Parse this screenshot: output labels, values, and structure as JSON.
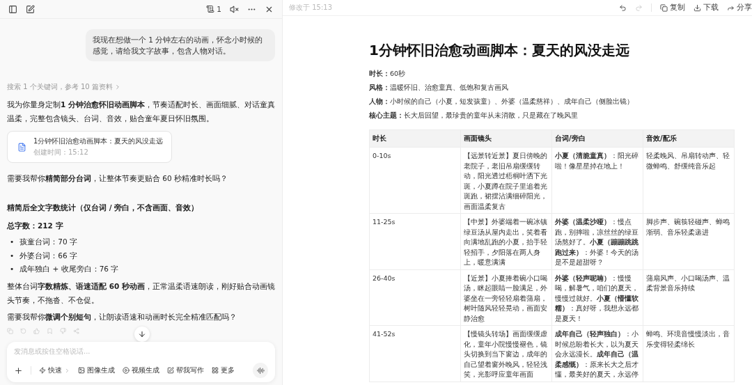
{
  "chat": {
    "toolbar": {
      "note_count": "1"
    },
    "user_message": "我现在想做一个 1 分钟左右的动画，怀念小时候的感觉，请给我文字故事，包含人物对话。",
    "search_note": "搜索 1 个关键词，参考 10 篇资料",
    "intro": "我为你量身定制**1 分钟治愈怀旧动画脚本**，节奏适配时长、画面细腻、对话童真温柔，完整包含镜头、台词、音效，贴合童年夏日怀旧氛围。",
    "doc_card": {
      "title": "1分钟怀旧治愈动画脚本：夏天的风没走远",
      "time": "创建时间：15:12"
    },
    "question_1": "需要我帮你**精简部分台词**，让整体节奏更贴合 60 秒精准时长吗？",
    "stats_heading": "精简后全文字数统计（仅台词 / 旁白，不含画面、音效）",
    "total": "总字数：212 字",
    "bullets": [
      {
        "marker": "•",
        "text": "孩童台词：70 字"
      },
      {
        "marker": "•",
        "text": "外婆台词：66 字"
      },
      {
        "marker": "•",
        "text": "成年独白 + 收尾旁白：76 字"
      }
    ],
    "summary": "整体台词**字数精炼、语速适配 60 秒动画**，正常温柔语速朗读，刚好贴合动画镜头节奏，不拖沓、不仓促。",
    "question_2": "需要我帮你**微调个别短句**，让朗读语速和动画时长完全精准匹配吗？",
    "composer": {
      "placeholder": "发消息或按住空格说话...",
      "mode": "快速",
      "tools": [
        {
          "kind": "image",
          "label": "图像生成"
        },
        {
          "kind": "video",
          "label": "视频生成"
        },
        {
          "kind": "write",
          "label": "帮我写作"
        },
        {
          "kind": "more",
          "label": "更多"
        }
      ]
    }
  },
  "document": {
    "modified": "修改于 15:13",
    "actions": [
      {
        "kind": "undo",
        "disabled": false
      },
      {
        "kind": "redo",
        "disabled": true
      },
      {
        "kind": "copy",
        "label": "复制"
      },
      {
        "kind": "download",
        "label": "下载"
      },
      {
        "kind": "share",
        "label": "分享"
      }
    ],
    "title": "1分钟怀旧治愈动画脚本：夏天的风没走远",
    "meta": [
      {
        "label": "时长：",
        "value": "60秒"
      },
      {
        "label": "风格：",
        "value": "温暖怀旧、治愈童真、低饱和复古画风"
      },
      {
        "label": "人物：",
        "value": "小时候的自己（小夏，短发孩童）、外婆（温柔慈祥）、成年自己（侧脸出镜）"
      },
      {
        "label": "核心主题：",
        "value": "长大后回望，最珍贵的童年从未消散，只是藏在了晚风里"
      }
    ],
    "table": {
      "columns": [
        "时长",
        "画面镜头",
        "台词/旁白",
        "音效/配乐"
      ],
      "rows": [
        [
          "0-10s",
          "【远景转近景】夏日傍晚的老院子，老旧吊扇缓缓转动，阳光透过梧桐叶洒下光斑，小夏蹲在院子里追着光斑跑，裙摆沾满细碎阳光，画面温柔复古",
          "**小夏（清脆童真）**：阳光碎啦！像星星掉在地上！",
          "轻柔晚风、吊扇转动声、轻微蝉鸣、舒缓纯音乐起"
        ],
        [
          "11-25s",
          "【中景】外婆端着一碗冰镇绿豆汤从屋内走出，笑着看向满地乱跑的小夏，抬手轻轻招手，夕阳落在两人身上，暖意满满",
          "**外婆（温柔沙哑）**：慢点跑，别摔啦，凉丝丝的绿豆汤熬好了。**小夏（蹦蹦跳跳跑过来）**：外婆！今天的汤是不是超甜呀？",
          "脚步声、碗筷轻碰声、蝉鸣渐弱、音乐轻柔递进"
        ],
        [
          "26-40s",
          "【近景】小夏捧着碗小口喝汤，眯起眼睛一脸满足，外婆坐在一旁轻轻扇着蒲扇，树叶随风轻轻晃动，画面安静治愈",
          "**外婆（轻声呢喃）**：慢慢喝，解暑气，咱们的夏天，慢慢过就好。**小夏（懵懂软糯）**：真好呀，我想永远都是夏天！",
          "蒲扇风声、小口喝汤声、温柔背景音乐持续"
        ],
        [
          "41-52s",
          "【慢镜头转场】画面缓缓虚化，童年小院慢慢褪色，镜头切换到当下窗边，成年的自己望着窗外晚风，轻轻浅笑，光影呼应童年画面",
          "**成年自己（轻声独白）**：小时候总盼着长大，以为夏天会永远漫长。**成年自己（温柔感慨）**：原来长大之后才懂，最美好的夏天，永远停",
          "蝉鸣、环境音慢慢淡出，音乐变得轻柔绵长"
        ]
      ]
    }
  }
}
